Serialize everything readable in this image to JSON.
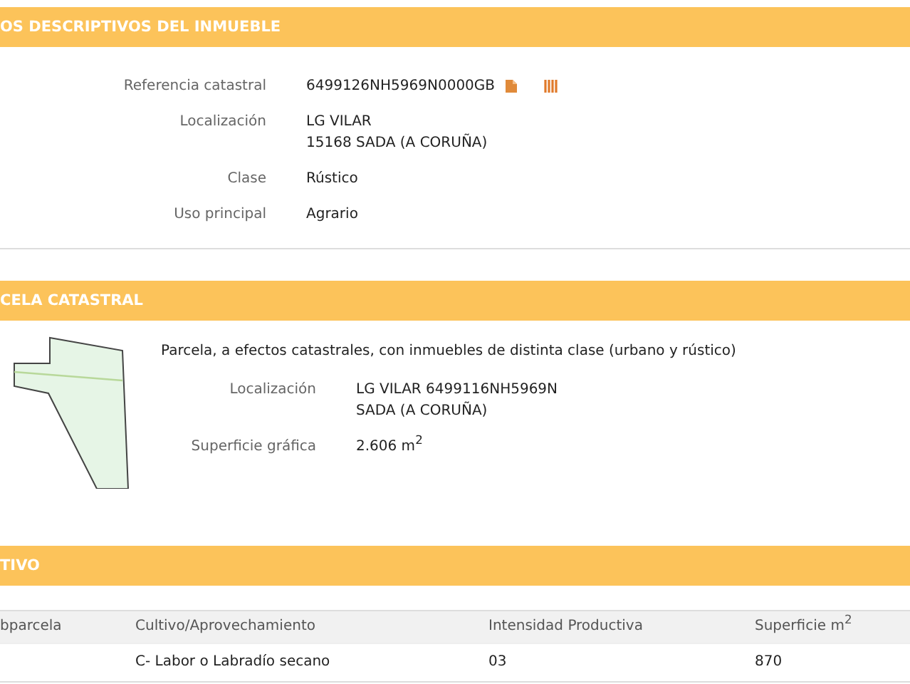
{
  "sections": [
    {
      "title": "OS DESCRIPTIVOS DEL INMUEBLE",
      "kind": "fields",
      "fields": [
        {
          "label": "Referencia catastral",
          "lines": [
            "6499126NH5969N0000GB"
          ],
          "icons": true
        },
        {
          "label": "Localización",
          "lines": [
            "LG VILAR",
            "15168 SADA (A CORUÑA)"
          ]
        },
        {
          "label": "Clase",
          "lines": [
            "Rústico"
          ]
        },
        {
          "label": "Uso principal",
          "lines": [
            "Agrario"
          ]
        }
      ]
    },
    {
      "title": "CELA CATASTRAL",
      "kind": "parcel",
      "description": "Parcela, a efectos catastrales, con inmuebles de distinta clase (urbano y rústico)",
      "fields": [
        {
          "label": "Localización",
          "lines": [
            "LG VILAR 6499116NH5969N",
            "SADA (A CORUÑA)"
          ]
        },
        {
          "label": "Superficie gráfica",
          "lines": [
            "2.606 m$^{2}$"
          ]
        }
      ]
    },
    {
      "title": "TIVO",
      "kind": "table",
      "columns": [
        "bparcela",
        "Cultivo/Aprovechamiento",
        "Intensidad Productiva",
        "Superficie m$^{2}$"
      ],
      "rows": [
        [
          "",
          "C- Labor o Labradío secano",
          "03",
          "870"
        ]
      ]
    }
  ]
}
